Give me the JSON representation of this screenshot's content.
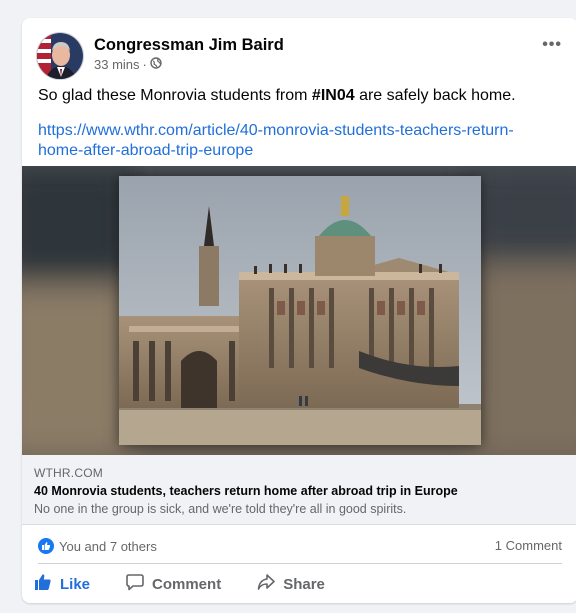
{
  "post": {
    "author": "Congressman Jim Baird",
    "time": "33 mins",
    "separator": "·",
    "privacy_icon": "globe-icon",
    "more_icon": "more-dots-icon",
    "more_label": "•••",
    "text_before": "So glad these Monrovia students from ",
    "hashtag": "#IN04",
    "text_after": " are safely back home.",
    "link_url": "https://www.wthr.com/article/40-monrovia-students-teachers-return-home-after-abroad-trip-europe"
  },
  "link_preview": {
    "domain": "WTHR.COM",
    "headline": "40 Monrovia students, teachers return home after abroad trip in Europe",
    "description": "No one in the group is sick, and we're told they're all in good spirits."
  },
  "reactions": {
    "summary": "You and 7 others",
    "comments": "1 Comment"
  },
  "actions": {
    "like": "Like",
    "comment": "Comment",
    "share": "Share"
  },
  "colors": {
    "accent": "#216fdb",
    "like_blue": "#1877f2",
    "muted": "#65676b"
  }
}
